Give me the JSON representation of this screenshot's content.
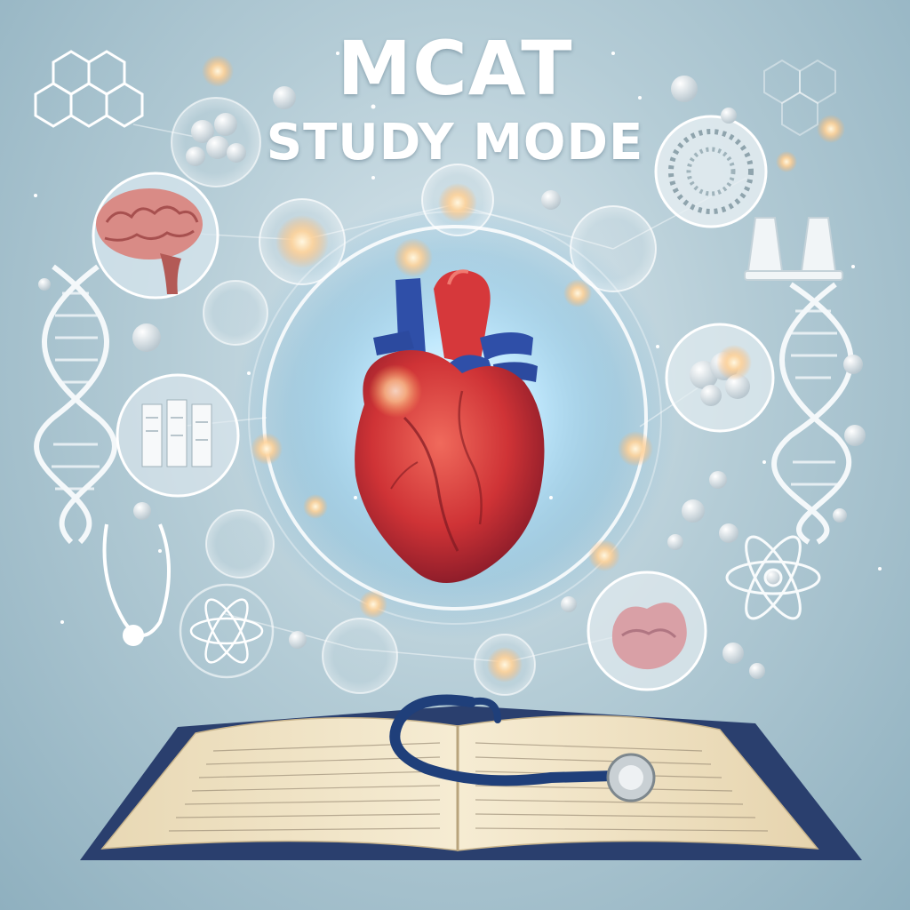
{
  "title": {
    "line1": "MCAT",
    "line2": "STUDY MODE"
  },
  "colors": {
    "background": "#a9c3cf",
    "glow": "#ffffff",
    "heart_red": "#d6383b",
    "heart_blue": "#2f4fa8",
    "title_text": "#ffffff",
    "book_cover": "#2a3f6e"
  },
  "icons": [
    "heart-icon",
    "brain-icon",
    "dna-helix-icon",
    "hexagon-molecule-icon",
    "stethoscope-icon",
    "open-book-icon",
    "test-tube-icon",
    "atom-icon",
    "cell-icon",
    "lung-icon"
  ]
}
